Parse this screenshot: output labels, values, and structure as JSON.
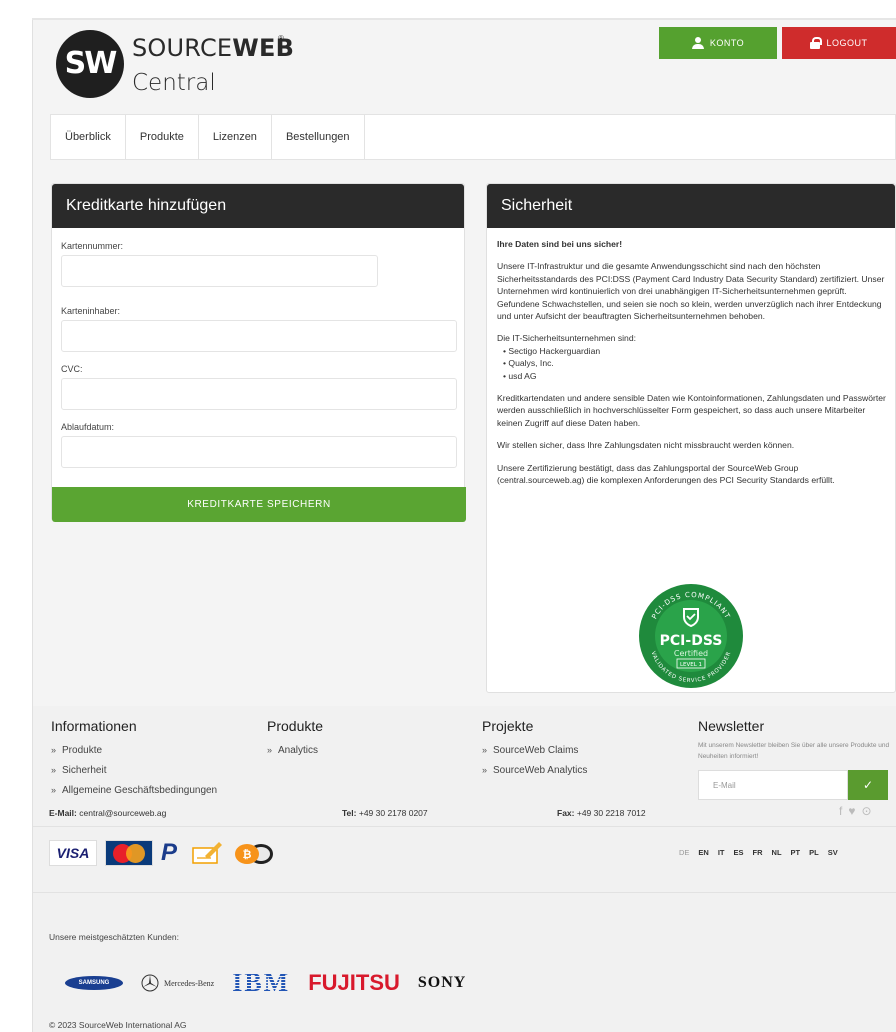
{
  "brand": {
    "name_light": "SOURCE",
    "name_bold": "WEB",
    "reg": "®",
    "sub": "Central",
    "mark": "SW"
  },
  "header": {
    "konto_label": "KONTO",
    "logout_label": "LOGOUT"
  },
  "nav": {
    "items": [
      "Überblick",
      "Produkte",
      "Lizenzen",
      "Bestellungen"
    ]
  },
  "card_form": {
    "title": "Kreditkarte hinzufügen",
    "fields": [
      {
        "label": "Kartennummer:",
        "value": ""
      },
      {
        "label": "Karteninhaber:",
        "value": ""
      },
      {
        "label": "CVC:",
        "value": ""
      },
      {
        "label": "Ablaufdatum:",
        "value": ""
      }
    ],
    "save_label": "KREDITKARTE SPEICHERN"
  },
  "security": {
    "title": "Sicherheit",
    "headline": "Ihre Daten sind bei uns sicher!",
    "p1": "Unsere IT-Infrastruktur und die gesamte Anwendungsschicht sind nach den höchsten Sicherheitsstandards des PCI:DSS (Payment Card Industry Data Security Standard) zertifiziert. Unser Unternehmen wird kontinuierlich von drei unabhängigen IT-Sicherheitsunternehmen geprüft. Gefundene Schwachstellen, und seien sie noch so klein, werden unverzüglich nach ihrer Entdeckung und unter Aufsicht der beauftragten Sicherheitsunternehmen behoben.",
    "list_intro": "Die IT-Sicherheitsunternehmen sind:",
    "list": [
      "Sectigo Hackerguardian",
      "Qualys, Inc.",
      "usd AG"
    ],
    "p2": "Kreditkartendaten und andere sensible Daten wie Kontoinformationen, Zahlungsdaten und Passwörter werden ausschließlich in hochverschlüsselter Form gespeichert, so dass auch unsere Mitarbeiter keinen Zugriff auf diese Daten haben.",
    "p3": "Wir stellen sicher, dass Ihre Zahlungsdaten nicht missbraucht werden können.",
    "p4": "Unsere Zertifizierung bestätigt, dass das Zahlungsportal der SourceWeb Group (central.sourceweb.ag) die komplexen Anforderungen des PCI Security Standards erfüllt.",
    "badge": {
      "top": "PCI-DSS COMPLIANT",
      "main": "PCI-DSS",
      "certified": "Certified",
      "level": "LEVEL 1",
      "bottom": "VALIDATED SERVICE PROVIDER"
    }
  },
  "footer": {
    "info_title": "Informationen",
    "info_links": [
      "Produkte",
      "Sicherheit",
      "Allgemeine Geschäftsbedingungen"
    ],
    "products_title": "Produkte",
    "products_links": [
      "Analytics"
    ],
    "projects_title": "Projekte",
    "projects_links": [
      "SourceWeb Claims",
      "SourceWeb Analytics"
    ],
    "newsletter_title": "Newsletter",
    "newsletter_text": "Mit unserem Newsletter bleiben Sie über alle unsere Produkte und Neuheiten informiert!",
    "newsletter_placeholder": "E-Mail",
    "email_label": "E-Mail:",
    "email_value": "central@sourceweb.ag",
    "tel_label": "Tel:",
    "tel_value": "+49 30 2178 0207",
    "fax_label": "Fax:",
    "fax_value": "+49 30 2218 7012",
    "payments": {
      "visa": "VISA",
      "mastercard": "MasterCard",
      "paypal": "P"
    },
    "languages": [
      "DE",
      "EN",
      "IT",
      "ES",
      "FR",
      "NL",
      "PT",
      "PL",
      "SV"
    ],
    "active_language": "DE",
    "customers_title": "Unsere meistgeschätzten Kunden:",
    "customers": {
      "samsung": "SAMSUNG",
      "mercedes": "Mercedes-Benz",
      "ibm": "IBM",
      "fujitsu": "FUJITSU",
      "sony": "SONY"
    },
    "copyright": "© 2023 SourceWeb International AG"
  },
  "colors": {
    "green": "#55a12f",
    "red": "#cf2c2c",
    "dark": "#2a2a2a",
    "pci_green": "#1f8a3c"
  }
}
